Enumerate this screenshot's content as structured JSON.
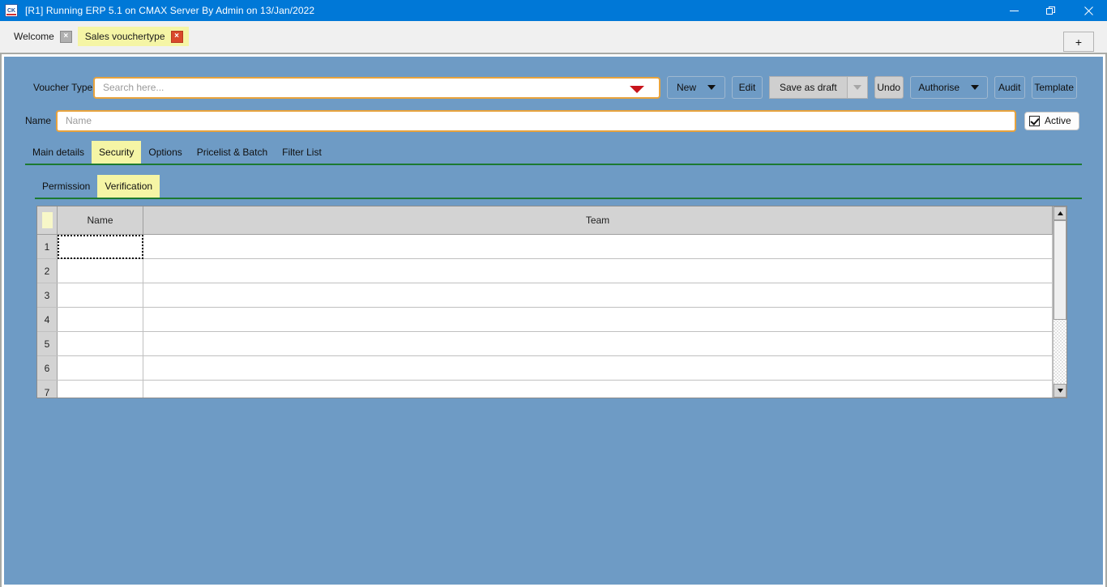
{
  "window": {
    "title": "[R1] Running ERP 5.1 on CMAX Server By Admin on 13/Jan/2022",
    "app_icon_text": "CK",
    "minimize_icon": "minimize-icon",
    "restore_icon": "restore-icon",
    "close_icon": "close-icon",
    "accent_color": "#0078d7"
  },
  "doc_tabs": {
    "add_label": "+",
    "close_glyph": "×",
    "items": [
      {
        "label": "Welcome",
        "active": false
      },
      {
        "label": "Sales vouchertype",
        "active": true
      }
    ]
  },
  "form": {
    "voucher_type_label": "Voucher Type",
    "voucher_type_value": "",
    "voucher_type_placeholder": "Search here...",
    "name_label": "Name",
    "name_value": "",
    "name_placeholder": "Name",
    "active_label": "Active",
    "active_checked": true,
    "field_border_color": "#e8a33d",
    "dropdown_arrow_color": "#c8141b"
  },
  "toolbar": {
    "new_label": "New",
    "edit_label": "Edit",
    "save_as_draft_label": "Save as draft",
    "undo_label": "Undo",
    "authorise_label": "Authorise",
    "audit_label": "Audit",
    "template_label": "Template"
  },
  "tabs": {
    "active_color": "#f5f5a5",
    "underline_color": "#1c7a30",
    "items": [
      {
        "label": "Main details",
        "active": false
      },
      {
        "label": "Security",
        "active": true
      },
      {
        "label": "Options",
        "active": false
      },
      {
        "label": "Pricelist & Batch",
        "active": false
      },
      {
        "label": "Filter List",
        "active": false
      }
    ]
  },
  "subtabs": {
    "items": [
      {
        "label": "Permission",
        "active": false
      },
      {
        "label": "Verification",
        "active": true
      }
    ]
  },
  "grid": {
    "columns": [
      "",
      "Name",
      "Team"
    ],
    "rows": [
      {
        "num": "1",
        "name": "",
        "team": "",
        "selected": true
      },
      {
        "num": "2",
        "name": "",
        "team": "",
        "selected": false
      },
      {
        "num": "3",
        "name": "",
        "team": "",
        "selected": false
      },
      {
        "num": "4",
        "name": "",
        "team": "",
        "selected": false
      },
      {
        "num": "5",
        "name": "",
        "team": "",
        "selected": false
      },
      {
        "num": "6",
        "name": "",
        "team": "",
        "selected": false
      },
      {
        "num": "7",
        "name": "",
        "team": "",
        "selected": false
      }
    ]
  }
}
